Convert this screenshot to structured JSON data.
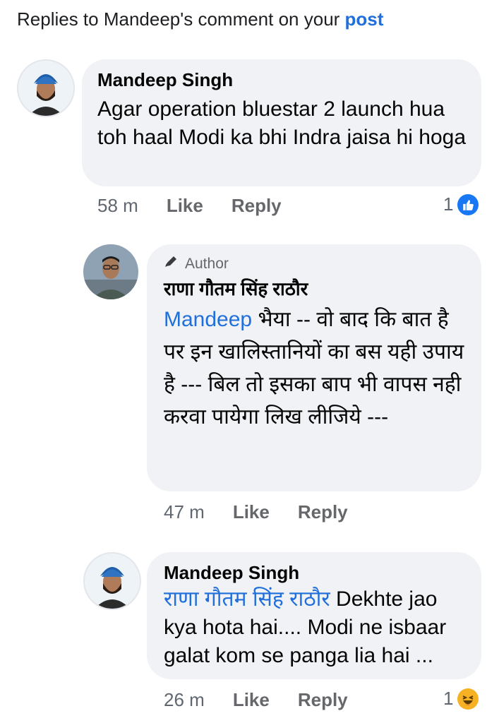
{
  "header": {
    "prefix": "Replies to Mandeep's comment on your",
    "link": "post"
  },
  "comments": [
    {
      "name": "Mandeep Singh",
      "text": "Agar operation bluestar 2 launch hua toh haal Modi ka bhi Indra jaisa hi hoga",
      "time": "58 m",
      "like_label": "Like",
      "reply_label": "Reply",
      "reaction_count": "1",
      "reaction_icon": "like-icon",
      "reaction_color": "#1877f2"
    },
    {
      "badge": "Author",
      "name": "राणा गौतम सिंह राठौर",
      "mention": "Mandeep",
      "text": " भैया -- वो बाद कि बात है पर इन खालिस्तानियों का बस यही उपाय है --- बिल तो इसका बाप भी वापस नही करवा पायेगा लिख लीजिये ---",
      "time": "47 m",
      "like_label": "Like",
      "reply_label": "Reply"
    },
    {
      "name": "Mandeep Singh",
      "mention": "राणा गौतम सिंह राठौर",
      "text": " Dekhte jao kya hota hai.... Modi ne isbaar galat kom se panga lia hai ...",
      "time": "26 m",
      "like_label": "Like",
      "reply_label": "Reply",
      "reaction_count": "1",
      "reaction_icon": "haha-icon",
      "reaction_color": "#f7b125"
    }
  ],
  "colors": {
    "link": "#216fdb",
    "bubble": "#f0f2f5",
    "meta": "#65676b"
  }
}
